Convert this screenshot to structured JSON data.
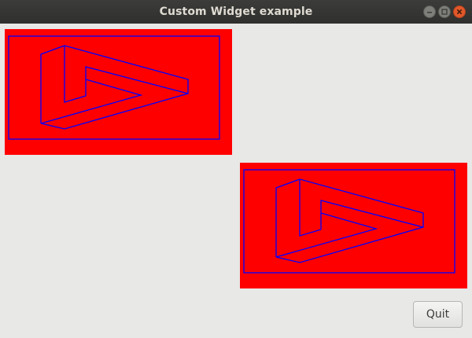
{
  "window": {
    "title": "Custom Widget example"
  },
  "colors": {
    "widget_background": "#ff0000",
    "widget_stroke": "#0000ff",
    "window_background": "#e8e8e7",
    "titlebar_background": "#2f2f2d",
    "close_button": "#e2582a"
  },
  "titlebar_buttons": [
    "minimize-icon",
    "maximize-icon",
    "close-icon"
  ],
  "widgets": [
    {
      "name": "custom-widget-1",
      "shape": "impossible-triangle"
    },
    {
      "name": "custom-widget-2",
      "shape": "impossible-triangle"
    }
  ],
  "actions": {
    "quit_label": "Quit"
  }
}
